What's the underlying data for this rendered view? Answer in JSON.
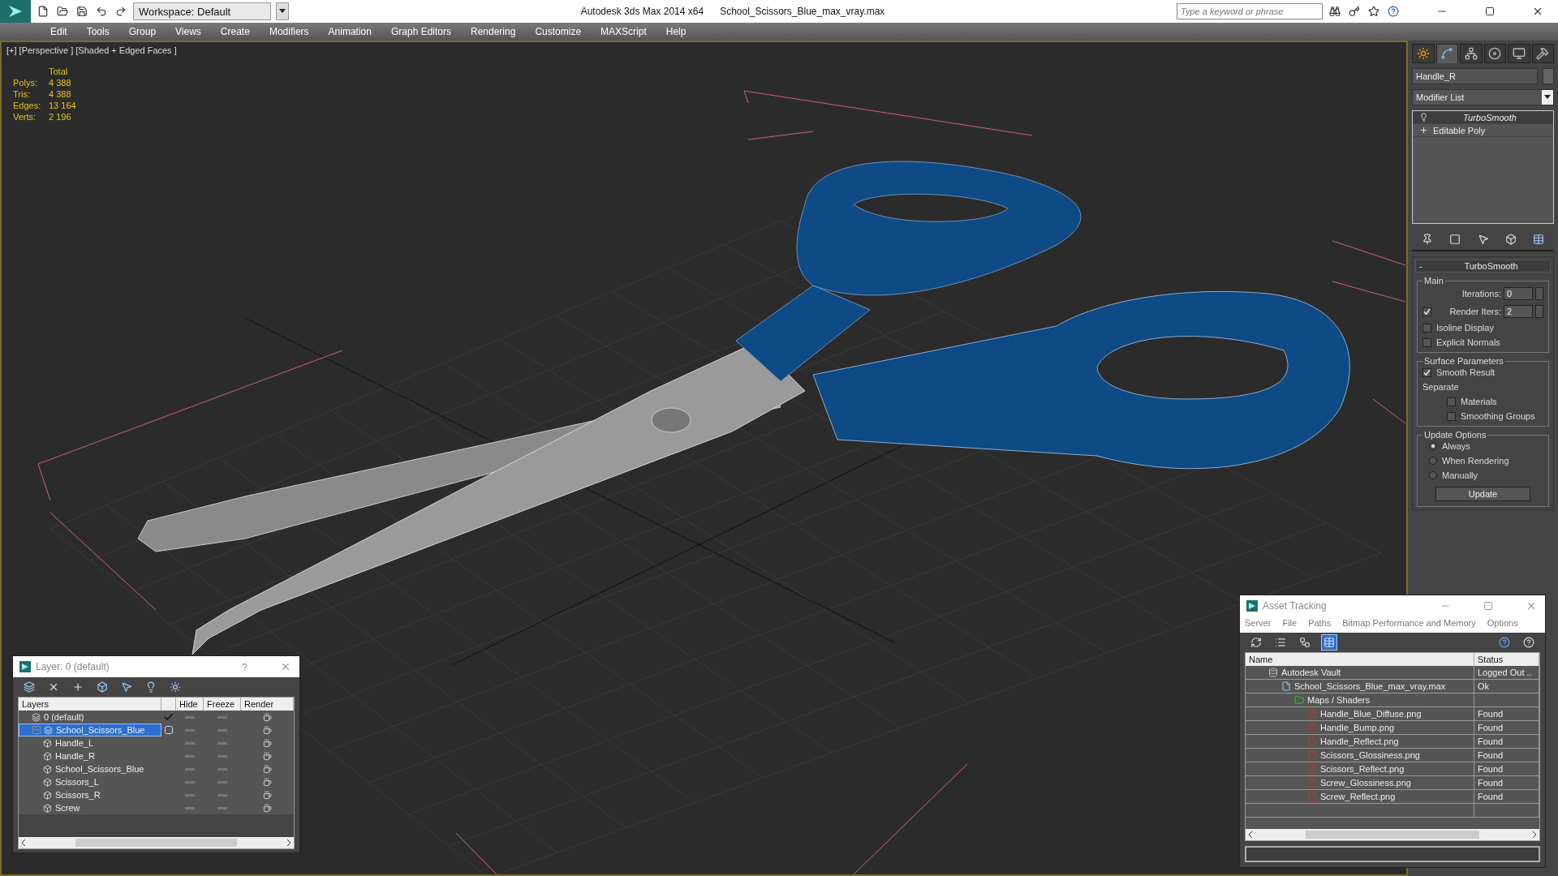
{
  "title_bar": {
    "workspace": "Workspace: Default",
    "app": "Autodesk 3ds Max  2014 x64",
    "file": "School_Scissors_Blue_max_vray.max",
    "search": {
      "placeholder": "Type a keyword or phrase"
    }
  },
  "menu": [
    "Edit",
    "Tools",
    "Group",
    "Views",
    "Create",
    "Modifiers",
    "Animation",
    "Graph Editors",
    "Rendering",
    "Customize",
    "MAXScript",
    "Help"
  ],
  "viewport": {
    "label": "[+] [Perspective ] [Shaded + Edged Faces ]",
    "stats": {
      "header": "Total",
      "rows": [
        {
          "label": "Polys:",
          "value": "4 388"
        },
        {
          "label": "Tris:",
          "value": "4 388"
        },
        {
          "label": "Edges:",
          "value": "13 164"
        },
        {
          "label": "Verts:",
          "value": "2 196"
        }
      ]
    }
  },
  "command_panel": {
    "tabs": [
      {
        "kind": "create",
        "selected": false
      },
      {
        "kind": "modify",
        "selected": true
      },
      {
        "kind": "hierarchy",
        "selected": false
      },
      {
        "kind": "motion",
        "selected": false
      },
      {
        "kind": "display",
        "selected": false
      },
      {
        "kind": "utilities",
        "selected": false
      }
    ],
    "object_name": "Handle_R",
    "modifier_list": "Modifier List",
    "stack": [
      {
        "label": "TurboSmooth",
        "kind": "modifier",
        "selected": true
      },
      {
        "label": "Editable Poly",
        "kind": "base",
        "selected": false
      }
    ],
    "rollout": {
      "collapse": "-",
      "title": "TurboSmooth",
      "main": {
        "label": "Main",
        "iterations": {
          "label": "Iterations:",
          "value": "0"
        },
        "render_iters": {
          "label": "Render Iters:",
          "value": "2",
          "checked": true
        },
        "options": [
          {
            "label": "Isoline Display",
            "checked": false
          },
          {
            "label": "Explicit Normals",
            "checked": false
          }
        ]
      },
      "surface": {
        "label": "Surface Parameters",
        "smooth_result": {
          "label": "Smooth Result",
          "checked": true
        },
        "separate": "Separate",
        "options": [
          {
            "label": "Materials",
            "checked": false
          },
          {
            "label": "Smoothing Groups",
            "checked": false
          }
        ]
      },
      "update": {
        "label": "Update Options",
        "options": [
          {
            "label": "Always",
            "selected": true
          },
          {
            "label": "When Rendering",
            "selected": false
          },
          {
            "label": "Manually",
            "selected": false
          }
        ],
        "button": "Update"
      }
    }
  },
  "layer_dialog": {
    "title": "Layer: 0 (default)",
    "help": "?",
    "columns": [
      "Layers",
      "Hide",
      "Freeze",
      "Render"
    ],
    "rows": [
      {
        "name": "0 (default)",
        "current": true,
        "selected": false
      },
      {
        "name": "School_Scissors_Blue",
        "current": false,
        "selected": true,
        "expanded": true,
        "children": [
          {
            "name": "Handle_L"
          },
          {
            "name": "Handle_R"
          },
          {
            "name": "School_Scissors_Blue"
          },
          {
            "name": "Scissors_L"
          },
          {
            "name": "Scissors_R"
          },
          {
            "name": "Screw"
          }
        ]
      }
    ]
  },
  "asset_tracking": {
    "title": "Asset Tracking",
    "menu": [
      "Server",
      "File",
      "Paths",
      "Bitmap Performance and Memory",
      "Options"
    ],
    "toolbar": [
      {
        "kind": "refresh",
        "selected": false
      },
      {
        "kind": "list",
        "selected": false
      },
      {
        "kind": "tree",
        "selected": false
      },
      {
        "kind": "table",
        "selected": true
      }
    ],
    "columns": [
      "Name",
      "Status"
    ],
    "rows": [
      {
        "kind": "vault",
        "name": "Autodesk Vault",
        "status": "Logged Out ..",
        "children": [
          {
            "kind": "max",
            "name": "School_Scissors_Blue_max_vray.max",
            "status": "Ok",
            "children": [
              {
                "kind": "folder",
                "name": "Maps / Shaders",
                "children": [
                  {
                    "kind": "png",
                    "name": "Handle_Blue_Diffuse.png",
                    "status": "Found"
                  },
                  {
                    "kind": "png",
                    "name": "Handle_Bump.png",
                    "status": "Found"
                  },
                  {
                    "kind": "png",
                    "name": "Handle_Reflect.png",
                    "status": "Found"
                  },
                  {
                    "kind": "png",
                    "name": "Scissors_Glossiness.png",
                    "status": "Found"
                  },
                  {
                    "kind": "png",
                    "name": "Scissors_Reflect.png",
                    "status": "Found"
                  },
                  {
                    "kind": "png",
                    "name": "Screw_Glossiness.png",
                    "status": "Found"
                  },
                  {
                    "kind": "png",
                    "name": "Screw_Reflect.png",
                    "status": "Found"
                  }
                ]
              }
            ]
          }
        ]
      }
    ]
  }
}
